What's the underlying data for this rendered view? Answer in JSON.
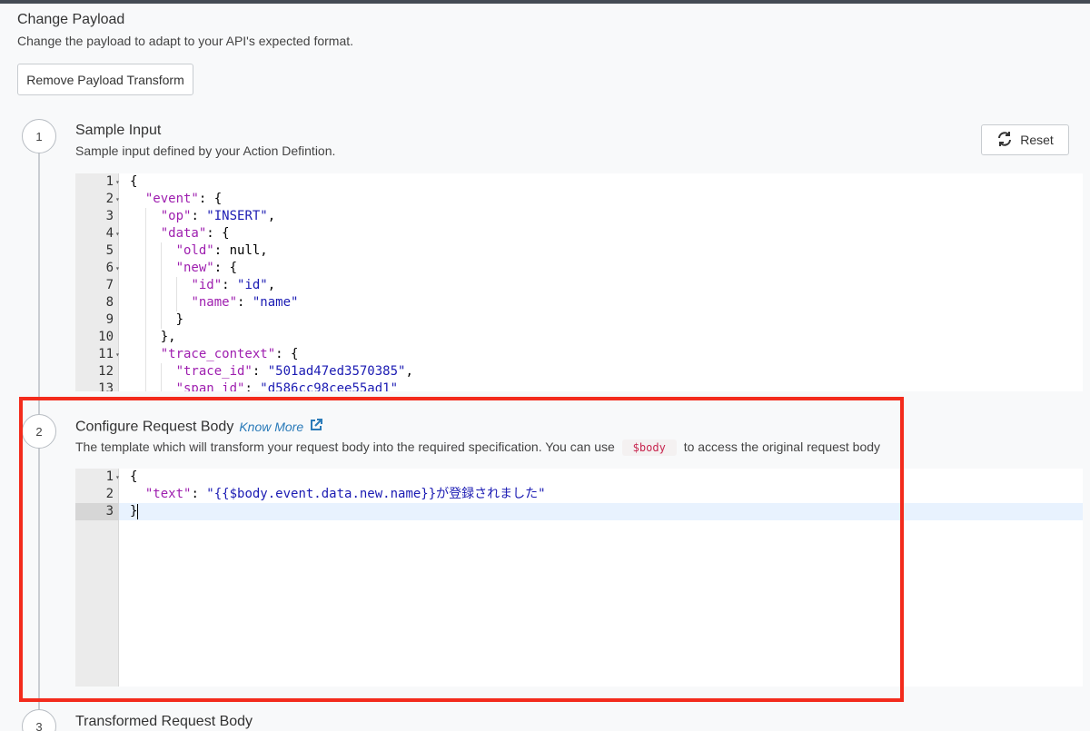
{
  "header": {
    "title": "Change Payload",
    "subtitle": "Change the payload to adapt to your API's expected format.",
    "remove_button": "Remove Payload Transform"
  },
  "steps": [
    {
      "number": "1",
      "title": "Sample Input",
      "subtitle": "Sample input defined by your Action Defintion.",
      "reset_button": "Reset"
    },
    {
      "number": "2",
      "title": "Configure Request Body",
      "know_more": "Know More",
      "subtitle_before": "The template which will transform your request body into the required specification. You can use",
      "code_chip": "$body",
      "subtitle_after": "to access the original request body"
    },
    {
      "number": "3",
      "title": "Transformed Request Body"
    }
  ],
  "sample_editor": {
    "lines": [
      {
        "n": "1",
        "fold": true,
        "parts": [
          [
            "p",
            "{"
          ]
        ]
      },
      {
        "n": "2",
        "fold": true,
        "parts": [
          [
            "p",
            "  "
          ],
          [
            "k",
            "\"event\""
          ],
          [
            "p",
            ": {"
          ]
        ]
      },
      {
        "n": "3",
        "fold": false,
        "parts": [
          [
            "p",
            "    "
          ],
          [
            "k",
            "\"op\""
          ],
          [
            "p",
            ": "
          ],
          [
            "s",
            "\"INSERT\""
          ],
          [
            "p",
            ","
          ]
        ]
      },
      {
        "n": "4",
        "fold": true,
        "parts": [
          [
            "p",
            "    "
          ],
          [
            "k",
            "\"data\""
          ],
          [
            "p",
            ": {"
          ]
        ]
      },
      {
        "n": "5",
        "fold": false,
        "parts": [
          [
            "p",
            "      "
          ],
          [
            "k",
            "\"old\""
          ],
          [
            "p",
            ": null,"
          ]
        ]
      },
      {
        "n": "6",
        "fold": true,
        "parts": [
          [
            "p",
            "      "
          ],
          [
            "k",
            "\"new\""
          ],
          [
            "p",
            ": {"
          ]
        ]
      },
      {
        "n": "7",
        "fold": false,
        "parts": [
          [
            "p",
            "        "
          ],
          [
            "k",
            "\"id\""
          ],
          [
            "p",
            ": "
          ],
          [
            "s",
            "\"id\""
          ],
          [
            "p",
            ","
          ]
        ]
      },
      {
        "n": "8",
        "fold": false,
        "parts": [
          [
            "p",
            "        "
          ],
          [
            "k",
            "\"name\""
          ],
          [
            "p",
            ": "
          ],
          [
            "s",
            "\"name\""
          ]
        ]
      },
      {
        "n": "9",
        "fold": false,
        "parts": [
          [
            "p",
            "      }"
          ]
        ]
      },
      {
        "n": "10",
        "fold": false,
        "parts": [
          [
            "p",
            "    },"
          ]
        ]
      },
      {
        "n": "11",
        "fold": true,
        "parts": [
          [
            "p",
            "    "
          ],
          [
            "k",
            "\"trace_context\""
          ],
          [
            "p",
            ": {"
          ]
        ]
      },
      {
        "n": "12",
        "fold": false,
        "parts": [
          [
            "p",
            "      "
          ],
          [
            "k",
            "\"trace_id\""
          ],
          [
            "p",
            ": "
          ],
          [
            "s",
            "\"501ad47ed3570385\""
          ],
          [
            "p",
            ","
          ]
        ]
      },
      {
        "n": "13",
        "fold": false,
        "parts": [
          [
            "p",
            "      "
          ],
          [
            "k",
            "\"span_id\""
          ],
          [
            "p",
            ": "
          ],
          [
            "s",
            "\"d586cc98cee55ad1\""
          ]
        ]
      }
    ]
  },
  "body_editor": {
    "lines": [
      {
        "n": "1",
        "fold": true,
        "parts": [
          [
            "p",
            "{"
          ]
        ]
      },
      {
        "n": "2",
        "fold": false,
        "parts": [
          [
            "p",
            "  "
          ],
          [
            "k",
            "\"text\""
          ],
          [
            "p",
            ": "
          ],
          [
            "s",
            "\"{{$body.event.data.new.name}}が登録されました\""
          ]
        ]
      },
      {
        "n": "3",
        "fold": false,
        "parts": [
          [
            "p",
            "}"
          ]
        ]
      }
    ]
  },
  "colors": {
    "highlight_border": "#f32b1c",
    "key": "#9e1eaf",
    "string": "#1b1bb3",
    "link": "#2b7bb9"
  }
}
